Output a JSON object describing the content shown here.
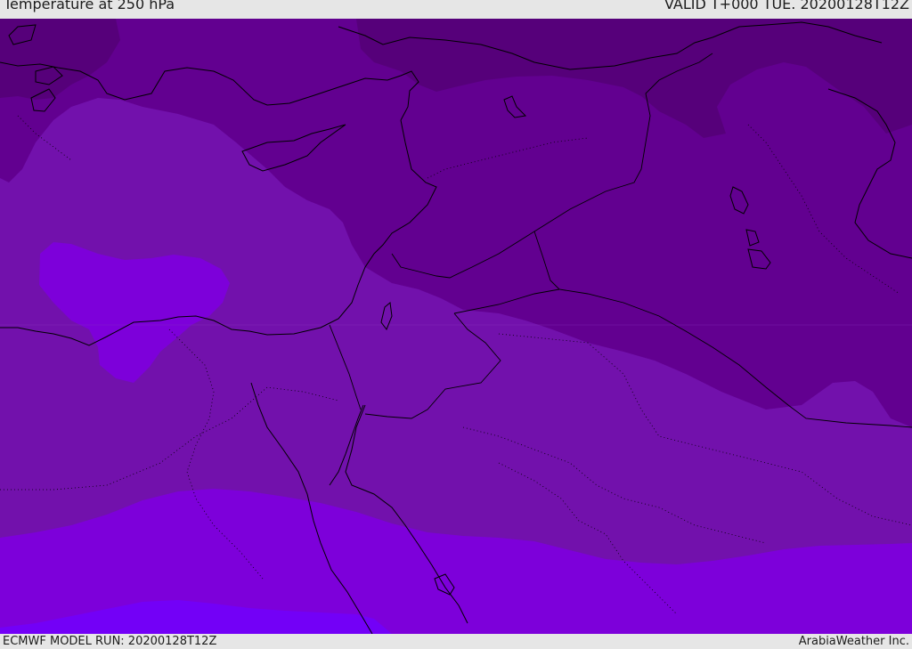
{
  "header": {
    "title": "Temperature at 250 hPa",
    "valid_time": "VALID T+000 TUE. 20200128T12Z"
  },
  "footer": {
    "model_run": "ECMWF MODEL RUN: 20200128T12Z",
    "credit": "ArabiaWeather Inc."
  },
  "colors": {
    "band_darkest": "#56007a",
    "band_dark": "#620090",
    "band_mid": "#7211ac",
    "band_light": "#7d00da",
    "band_lightest": "#7300f7",
    "coastline": "#000000"
  }
}
